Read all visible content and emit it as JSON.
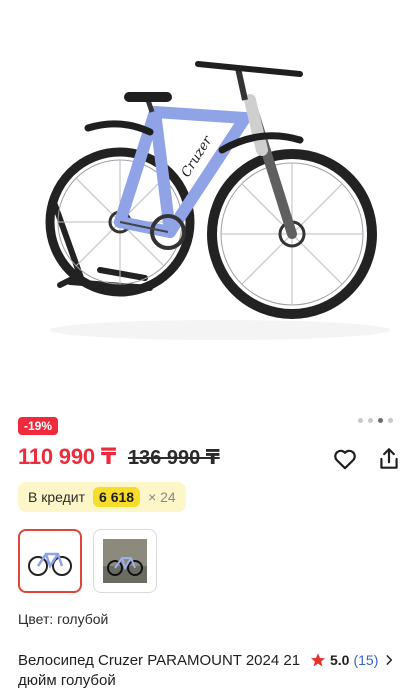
{
  "product": {
    "discount": "-19%",
    "price": "110 990 ₸",
    "old_price": "136 990 ₸",
    "credit": {
      "label": "В кредит",
      "amount": "6 618",
      "term": "× 24"
    },
    "color_line": "Цвет: голубой",
    "title": "Велосипед Cruzer PARAMOUNT 2024 21 дюйм голубой",
    "rating": {
      "value": "5.0",
      "count": "(15)"
    },
    "frame_color": "#8fa3e6",
    "accent_color": "#ee2a3b"
  },
  "gallery": {
    "dots_total": 4,
    "dots_active_index": 2
  },
  "thumbnails": [
    {
      "name": "bike-photo-thumb",
      "selected": true
    },
    {
      "name": "bike-lifestyle-thumb",
      "selected": false
    }
  ],
  "icons": [
    "heart-icon",
    "share-icon",
    "star-icon",
    "chevron-right-icon"
  ]
}
